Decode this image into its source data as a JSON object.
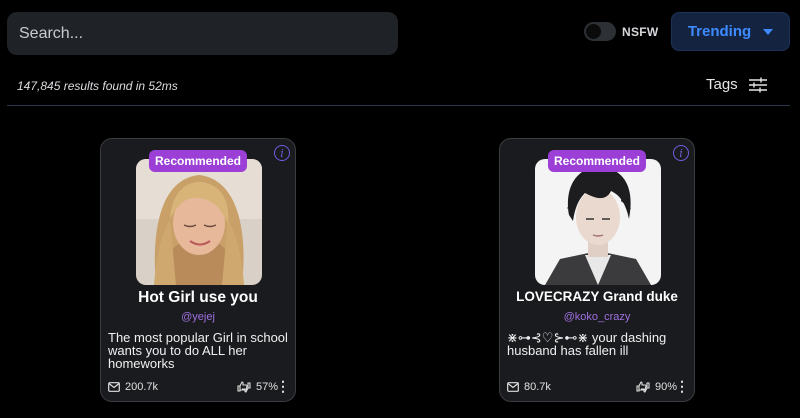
{
  "search": {
    "placeholder": "Search..."
  },
  "nsfw": {
    "label": "NSFW",
    "enabled": false
  },
  "sort": {
    "label": "Trending"
  },
  "results": {
    "summary": "147,845 results found in 52ms"
  },
  "tags": {
    "label": "Tags"
  },
  "cards": [
    {
      "badge": "Recommended",
      "name": "Hot Girl use you",
      "handle": "@yejej",
      "description": "The most popular Girl in school wants you to do ALL her homeworks",
      "messages": "200.7k",
      "rating": "57%"
    },
    {
      "badge": "Recommended",
      "name": "LOVECRAZY Grand duke",
      "handle": "@koko_crazy",
      "description": "⋇⊶⊰♡⊱⊷⋇ your dashing husband has fallen ill",
      "messages": "80.7k",
      "rating": "90%"
    }
  ],
  "colors": {
    "accent_blue": "#3d8bff",
    "badge_purple": "#9b3fd6",
    "handle_purple": "#a070e0"
  }
}
